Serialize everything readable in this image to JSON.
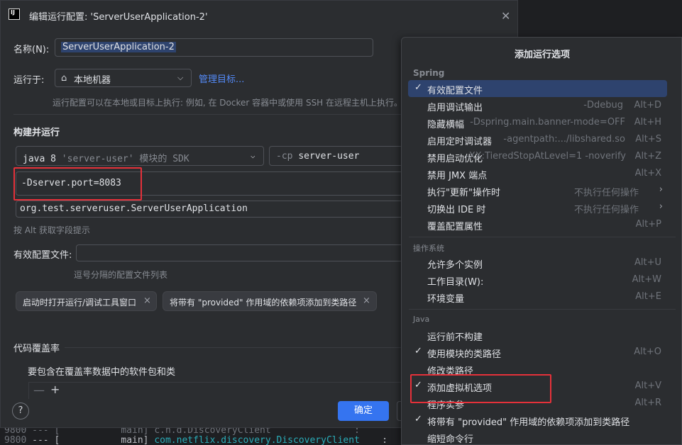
{
  "dialog": {
    "title": "编辑运行配置: 'ServerUserApplication-2'",
    "name_label": "名称(N):",
    "name_value": "ServerUserApplication-2",
    "run_on_label": "运行于:",
    "run_on_value": "本地机器",
    "manage_targets": "管理目标...",
    "run_on_hint": "运行配置可以在本地或目标上执行: 例如, 在 Docker 容器中或使用 SSH 在远程主机上执行。",
    "build_run_header": "构建并运行",
    "jdk_value": "java 8",
    "jdk_module": "'server-user'",
    "jdk_suffix": "模块的 SDK",
    "cp_flag": "-cp",
    "cp_value": "server-user",
    "vm_options": "-Dserver.port=8083",
    "main_class": "org.test.serveruser.ServerUserApplication",
    "alt_hint": "按 Alt 获取字段提示",
    "profiles_label": "有效配置文件:",
    "profiles_hint": "逗号分隔的配置文件列表",
    "chips": [
      "启动时打开运行/调试工具窗口",
      "将带有 \"provided\" 作用域的依赖项添加到类路径"
    ],
    "coverage_header": "代码覆盖率",
    "coverage_packages": "要包含在覆盖率数据中的软件包和类",
    "ok_label": "确定",
    "help_label": "?"
  },
  "background": {
    "line1": "9800 --- [           main] c.n.d.DiscoveryClient               :",
    "line2_num": "9800",
    "line2_mid": " --- [           main] ",
    "line2_class": "com.netflix.discovery.DiscoveryClient",
    "line2_end": "    :"
  },
  "popup": {
    "title": "添加运行选项",
    "groups": {
      "spring": "Spring",
      "os": "操作系统",
      "java": "Java"
    },
    "spring_items": [
      {
        "check": "✓",
        "name": "有效配置文件",
        "desc": "",
        "key": ""
      },
      {
        "check": "",
        "name": "启用调试输出",
        "desc": "-Ddebug",
        "key": "Alt+D"
      },
      {
        "check": "",
        "name": "隐藏横幅",
        "desc": "-Dspring.main.banner-mode=OFF",
        "key": "Alt+H"
      },
      {
        "check": "",
        "name": "启用定时调试器",
        "desc": "-agentpath:.../libshared.so",
        "key": "Alt+S"
      },
      {
        "check": "",
        "name": "禁用启动优化",
        "desc": "-XX:TieredStopAtLevel=1 -noverify",
        "key": "Alt+Z"
      },
      {
        "check": "",
        "name": "禁用 JMX 端点",
        "desc": "",
        "key": "Alt+X"
      },
      {
        "check": "",
        "name": "执行\"更新\"操作时",
        "desc": "不执行任何操作",
        "key": "",
        "sub": "›"
      },
      {
        "check": "",
        "name": "切换出 IDE 时",
        "desc": "不执行任何操作",
        "key": "",
        "sub": "›"
      },
      {
        "check": "",
        "name": "覆盖配置属性",
        "desc": "",
        "key": "Alt+P"
      }
    ],
    "os_items": [
      {
        "check": "",
        "name": "允许多个实例",
        "key": "Alt+U"
      },
      {
        "check": "",
        "name": "工作目录(W):",
        "key": "Alt+W"
      },
      {
        "check": "",
        "name": "环境变量",
        "key": "Alt+E"
      }
    ],
    "java_items": [
      {
        "check": "",
        "name": "运行前不构建",
        "key": ""
      },
      {
        "check": "✓",
        "name": "使用模块的类路径",
        "key": "Alt+O"
      },
      {
        "check": "",
        "name": "修改类路径",
        "key": ""
      },
      {
        "check": "✓",
        "name": "添加虚拟机选项",
        "key": "Alt+V"
      },
      {
        "check": "",
        "name": "程序实参",
        "key": "Alt+R"
      },
      {
        "check": "✓",
        "name": "将带有 \"provided\" 作用域的依赖项添加到类路径",
        "key": ""
      },
      {
        "check": "",
        "name": "缩短命令行",
        "key": ""
      }
    ]
  }
}
